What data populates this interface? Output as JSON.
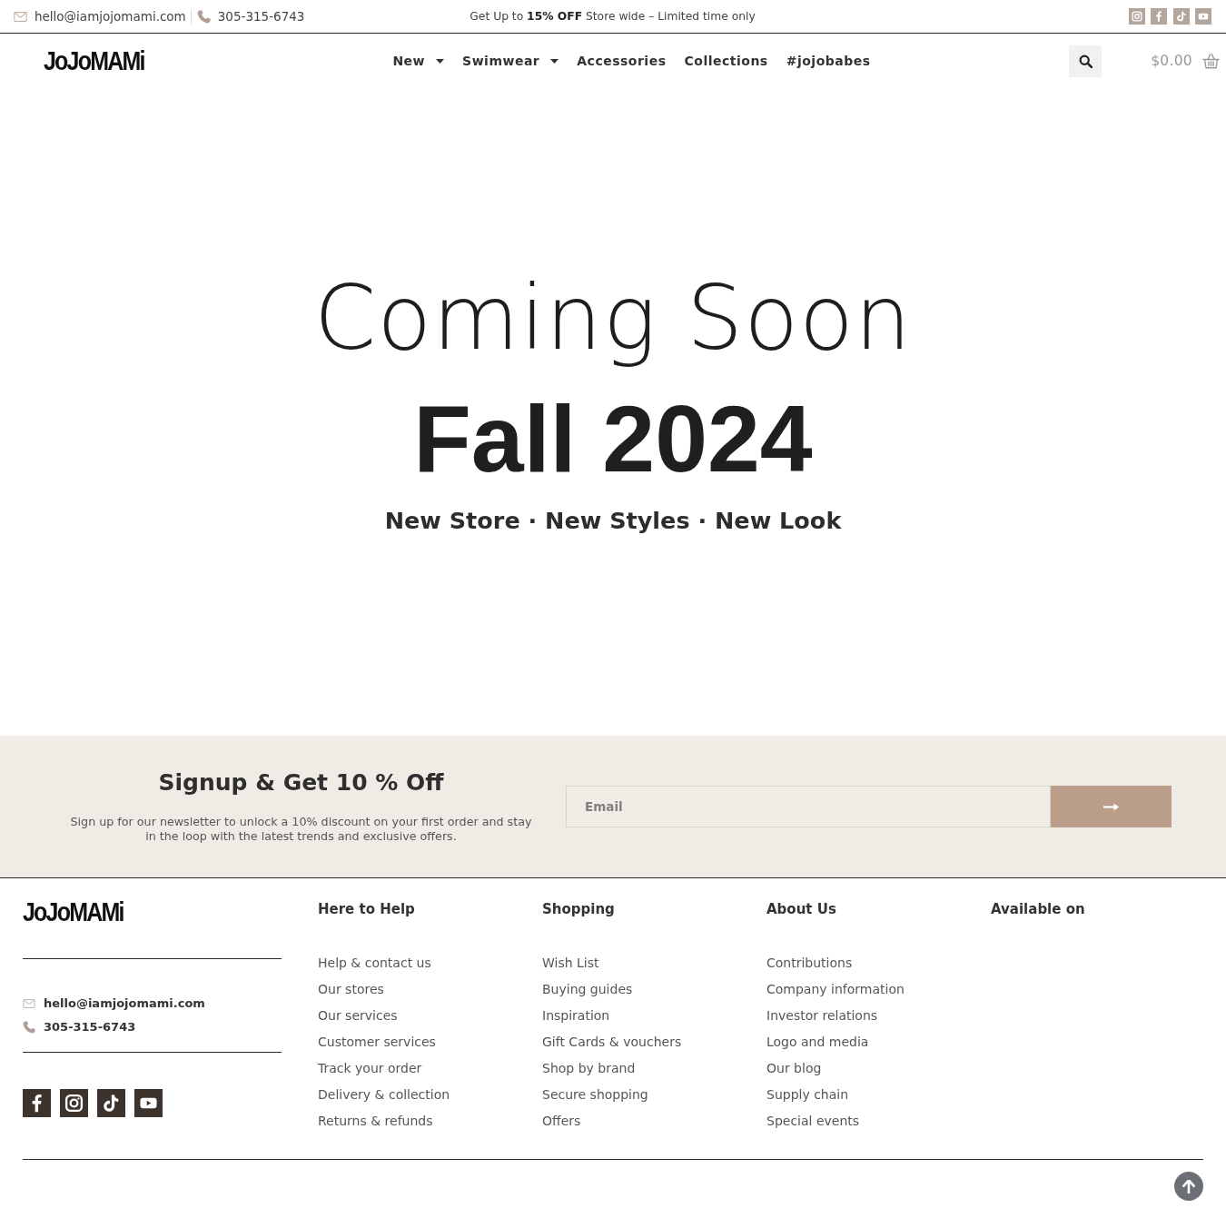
{
  "top_bar": {
    "email": "hello@iamjojomami.com",
    "phone": "305-315-6743",
    "promo": "Get Up to **15% OFF** Store wide – Limited time only",
    "social": [
      {
        "kind": "instagram"
      },
      {
        "kind": "facebook"
      },
      {
        "kind": "tiktok"
      },
      {
        "kind": "youtube"
      }
    ]
  },
  "header": {
    "logo": {
      "wordmark": "JoJoMAMi"
    },
    "nav": [
      {
        "label": "New",
        "dropdown": true
      },
      {
        "label": "Swimwear",
        "dropdown": true
      },
      {
        "label": "Accessories",
        "dropdown": false
      },
      {
        "label": "Collections",
        "dropdown": false
      },
      {
        "label": "#jojobabes",
        "dropdown": false
      }
    ],
    "cart_total": "$0.00"
  },
  "hero": {
    "title": "Coming Soon",
    "subtitle": "Fall 2024",
    "tagline": "New Store · New Styles · New Look"
  },
  "newsletter": {
    "heading": "Signup & Get 10 % Off",
    "text": "Sign up for our newsletter to unlock a 10% discount on your first order and stay in the loop with the latest trends and exclusive offers.",
    "email_field": {
      "placeholder": "Email"
    }
  },
  "footer": {
    "logo": {
      "wordmark": "JoJoMAMi"
    },
    "email": "hello@iamjojomami.com",
    "phone": "305-315-6743",
    "social": [
      {
        "kind": "facebook"
      },
      {
        "kind": "instagram"
      },
      {
        "kind": "tiktok"
      },
      {
        "kind": "youtube"
      }
    ],
    "columns": [
      {
        "heading": "Here to Help",
        "links": [
          "Help & contact us",
          "Our stores",
          "Our services",
          "Customer services",
          "Track your order",
          "Delivery & collection",
          "Returns & refunds"
        ]
      },
      {
        "heading": "Shopping",
        "links": [
          "Wish List",
          "Buying guides",
          "Inspiration",
          "Gift Cards & vouchers",
          "Shop by brand",
          "Secure shopping",
          "Offers"
        ]
      },
      {
        "heading": "About Us",
        "links": [
          "Contributions",
          "Company information",
          "Investor relations",
          "Logo and media",
          "Our blog",
          "Supply chain",
          "Special events"
        ]
      },
      {
        "heading": "Available on"
      }
    ]
  }
}
